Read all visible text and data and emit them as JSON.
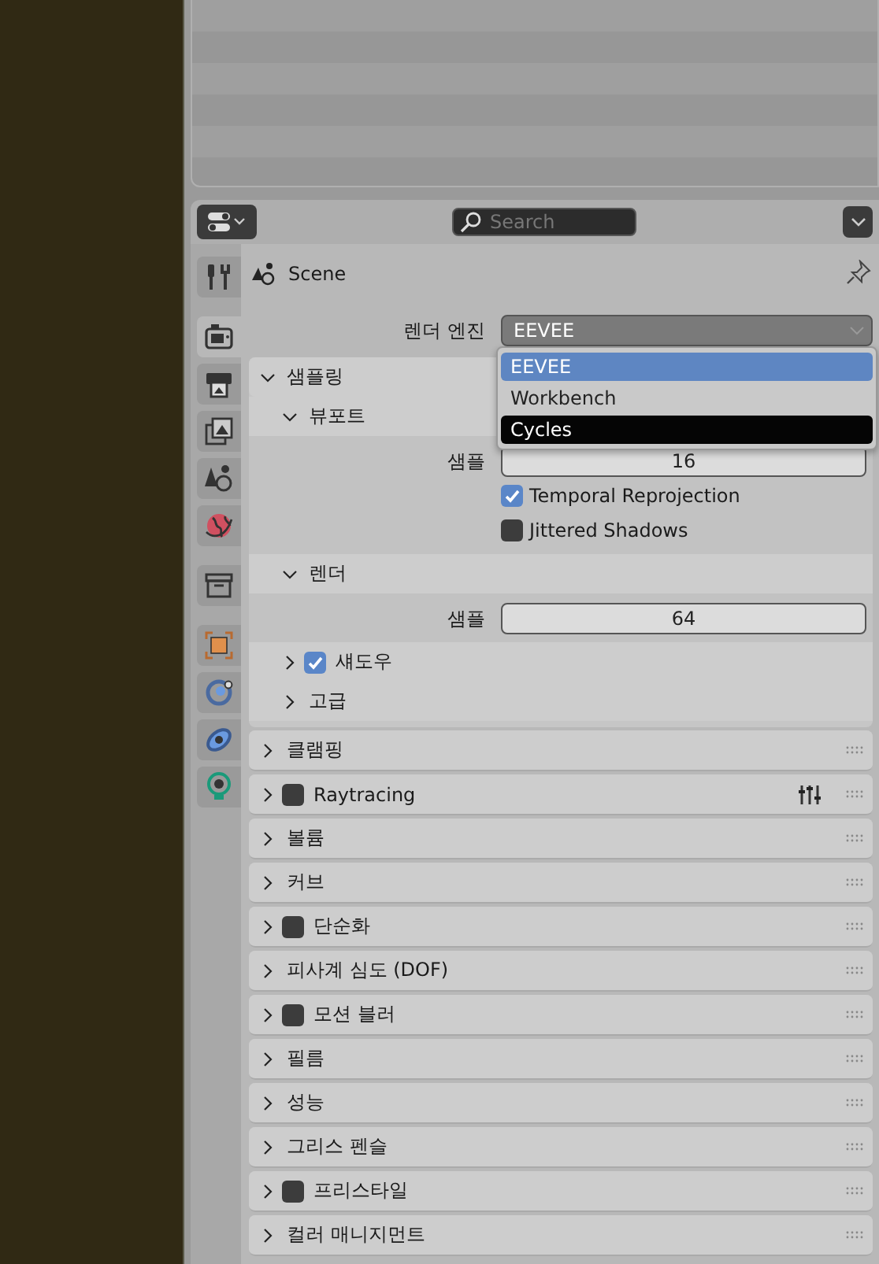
{
  "header": {
    "search": {
      "placeholder": "Search"
    }
  },
  "tabs": [
    {
      "kind": "tool",
      "selected": false
    },
    {
      "kind": "render",
      "selected": true
    },
    {
      "kind": "output",
      "selected": false
    },
    {
      "kind": "view-layer",
      "selected": false
    },
    {
      "kind": "scene",
      "selected": false
    },
    {
      "kind": "world",
      "selected": false
    },
    {
      "kind": "collection",
      "selected": false
    },
    {
      "kind": "object",
      "selected": false
    },
    {
      "kind": "constraint",
      "selected": false
    },
    {
      "kind": "physics",
      "selected": false
    },
    {
      "kind": "light",
      "selected": false
    }
  ],
  "context": {
    "label": "Scene",
    "pinned": false
  },
  "render_engine": {
    "label": "렌더 엔진",
    "value": "EEVEE",
    "menu": [
      {
        "label": "EEVEE",
        "selected": true,
        "hovered": false
      },
      {
        "label": "Workbench",
        "selected": false,
        "hovered": false
      },
      {
        "label": "Cycles",
        "selected": false,
        "hovered": true
      }
    ]
  },
  "sampling": {
    "title": "샘플링",
    "expanded": true,
    "subpanels": [
      {
        "title": "뷰포트",
        "expanded": true,
        "rows": [
          {
            "kind": "number",
            "label": "샘플",
            "value": "16"
          },
          {
            "kind": "checkbox",
            "label": "Temporal Reprojection",
            "checked": true
          },
          {
            "kind": "checkbox",
            "label": "Jittered Shadows",
            "checked": false
          }
        ]
      },
      {
        "title": "렌더",
        "expanded": true,
        "rows": [
          {
            "kind": "number",
            "label": "샘플",
            "value": "64"
          }
        ]
      },
      {
        "title": "섀도우",
        "expanded": false,
        "checked": true
      },
      {
        "title": "고급",
        "expanded": false
      }
    ]
  },
  "panels": [
    {
      "title": "클램핑",
      "expanded": false
    },
    {
      "title": "Raytracing",
      "expanded": false,
      "checked": false,
      "presets": true
    },
    {
      "title": "볼륨",
      "expanded": false
    },
    {
      "title": "커브",
      "expanded": false
    },
    {
      "title": "단순화",
      "expanded": false,
      "checked": false
    },
    {
      "title": "피사계 심도 (DOF)",
      "expanded": false
    },
    {
      "title": "모션 블러",
      "expanded": false,
      "checked": false
    },
    {
      "title": "필름",
      "expanded": false
    },
    {
      "title": "성능",
      "expanded": false
    },
    {
      "title": "그리스 펜슬",
      "expanded": false
    },
    {
      "title": "프리스타일",
      "expanded": false,
      "checked": false
    },
    {
      "title": "컬러 매니지먼트",
      "expanded": false
    }
  ]
}
